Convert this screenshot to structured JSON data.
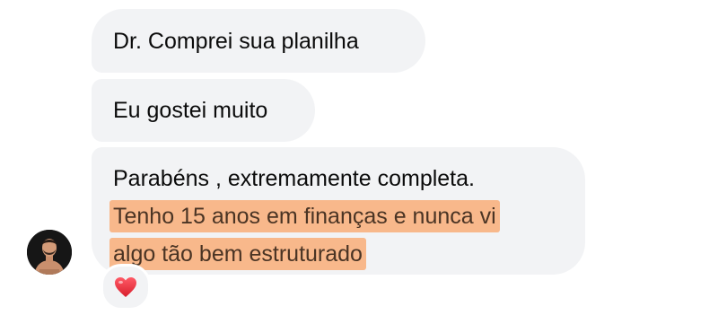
{
  "messages": [
    {
      "text": "Dr.  Comprei sua planilha"
    },
    {
      "text": "Eu gostei muito"
    },
    {
      "text": "Parabéns , extremamente completa.",
      "highlighted_lines": [
        "Tenho 15 anos em finanças e nunca vi",
        "algo tão bem estruturado"
      ]
    }
  ],
  "reaction": {
    "icon": "heart-icon",
    "color": "#e8303f"
  },
  "colors": {
    "bubble": "#f2f3f5",
    "highlight": "#f8b88b"
  }
}
